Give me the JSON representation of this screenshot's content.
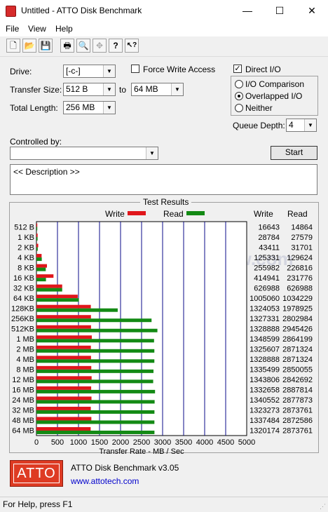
{
  "window": {
    "title": "Untitled - ATTO Disk Benchmark",
    "minimize_glyph": "—",
    "maximize_glyph": "☐",
    "close_glyph": "✕"
  },
  "menu": [
    "File",
    "View",
    "Help"
  ],
  "toolbar": {
    "buttons": [
      "new-document-icon",
      "open-folder-icon",
      "save-icon",
      "print-icon",
      "print-preview-icon",
      "move-icon",
      "help-icon",
      "context-help-icon"
    ],
    "glyphs": [
      "🗋",
      "📂",
      "💾",
      "🖶",
      "🔍",
      "✥",
      "?",
      "↖?"
    ]
  },
  "settings": {
    "drive_label": "Drive:",
    "drive_value": "[-c-]",
    "transfer_size_label": "Transfer Size:",
    "transfer_from": "512 B",
    "to_label": "to",
    "transfer_to": "64 MB",
    "total_length_label": "Total Length:",
    "total_length_value": "256 MB",
    "force_write_label": "Force Write Access",
    "force_write_checked": false,
    "direct_io_label": "Direct I/O",
    "direct_io_checked": true,
    "io_comparison_label": "I/O Comparison",
    "overlapped_io_label": "Overlapped I/O",
    "neither_label": "Neither",
    "selected_mode": "Overlapped I/O",
    "queue_depth_label": "Queue Depth:",
    "queue_depth_value": "4",
    "controlled_by_label": "Controlled by:",
    "controlled_by_value": "",
    "start_label": "Start",
    "arrow_glyph": "▼",
    "check_glyph": "✓"
  },
  "description": "<< Description >>",
  "results": {
    "title": "Test Results",
    "write_label": "Write",
    "read_label": "Read",
    "write_color": "#e0161b",
    "read_color": "#138a14",
    "write_col_header": "Write",
    "read_col_header": "Read",
    "watermark": "JagatReview.com"
  },
  "chart_data": {
    "type": "bar",
    "orientation": "horizontal",
    "categories": [
      "512 B",
      "1 KB",
      "2 KB",
      "4 KB",
      "8 KB",
      "16 KB",
      "32 KB",
      "64 KB",
      "128KB",
      "256KB",
      "512KB",
      "1 MB",
      "2 MB",
      "4 MB",
      "8 MB",
      "12 MB",
      "16 MB",
      "24 MB",
      "32 MB",
      "48 MB",
      "64 MB"
    ],
    "series": [
      {
        "name": "Write",
        "values": [
          16643,
          28784,
          43411,
          125331,
          255982,
          414941,
          626988,
          1005060,
          1324053,
          1327331,
          1328888,
          1348599,
          1325607,
          1328888,
          1335499,
          1343806,
          1332658,
          1340552,
          1323273,
          1337484,
          1320174
        ]
      },
      {
        "name": "Read",
        "values": [
          14864,
          27579,
          31701,
          129624,
          226816,
          231776,
          626988,
          1034229,
          1978925,
          2802984,
          2945426,
          2864199,
          2871324,
          2871324,
          2850055,
          2842692,
          2887814,
          2877873,
          2873761,
          2872586,
          2873761
        ]
      }
    ],
    "xlabel": "Transfer Rate - MB / Sec",
    "xticks": [
      0,
      500,
      1000,
      1500,
      2000,
      2500,
      3000,
      3500,
      4000,
      4500,
      5000
    ],
    "xlim": [
      0,
      5000
    ],
    "value_units": "KB/s",
    "legend": "top"
  },
  "footer": {
    "logo_text": "ATTO",
    "app_name": "ATTO Disk Benchmark v3.05",
    "website": "www.attotech.com"
  },
  "status": "For Help, press F1"
}
